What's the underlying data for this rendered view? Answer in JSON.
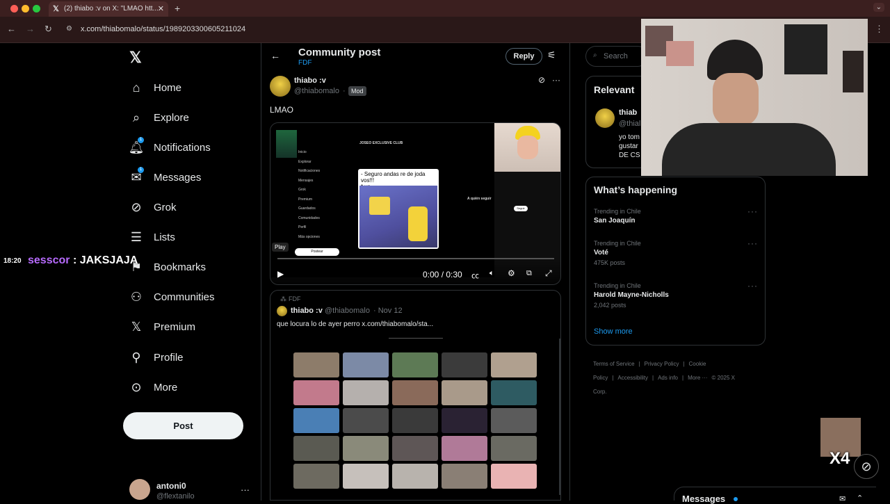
{
  "browser": {
    "tab_title": "(2) thiabo :v on X: \"LMAO htt...",
    "url": "x.com/thiabomalo/status/1989203300605211024"
  },
  "nav": {
    "items": [
      {
        "label": "Home",
        "icon": "home-icon"
      },
      {
        "label": "Explore",
        "icon": "search-icon"
      },
      {
        "label": "Notifications",
        "icon": "bell-icon",
        "badge": "1"
      },
      {
        "label": "Messages",
        "icon": "mail-icon",
        "badge": "1"
      },
      {
        "label": "Grok",
        "icon": "grok-icon"
      },
      {
        "label": "Lists",
        "icon": "list-icon"
      },
      {
        "label": "Bookmarks",
        "icon": "bookmark-icon"
      },
      {
        "label": "Communities",
        "icon": "people-icon"
      },
      {
        "label": "Premium",
        "icon": "x-icon"
      },
      {
        "label": "Profile",
        "icon": "person-icon"
      },
      {
        "label": "More",
        "icon": "more-circle-icon"
      }
    ],
    "post_label": "Post",
    "account": {
      "name": "antoni0",
      "handle": "@flextanilo"
    }
  },
  "chat_overlay": {
    "time": "18:20",
    "user": "sesscor",
    "sep": ":",
    "message": "JAKSJAJA"
  },
  "header": {
    "title": "Community post",
    "subtitle": "FDF",
    "reply_label": "Reply"
  },
  "post": {
    "author": "thiabo :v",
    "handle": "@thiabomalo",
    "dot": "·",
    "mod_badge": "Mod",
    "text": "LMAO",
    "video": {
      "play_label": "Play",
      "time": "0:00 / 0:30",
      "inner_header": "JOSEO EXCLUSIVE CLUB",
      "inner_bubble": "- Seguro andas re de joda vos!!!\n* yo ...",
      "inner_menu": [
        "Inicio",
        "Explorar",
        "Notificaciones",
        "Mensajes",
        "Grok",
        "Premium",
        "Guardados",
        "Comunidades",
        "Perfil",
        "Más opciones"
      ],
      "inner_post": "Postear",
      "inner_follow_title": "A quién seguir",
      "inner_follow": "Seguir"
    }
  },
  "quote": {
    "community": "FDF",
    "author": "thiabo :v",
    "handle": "@thiabomalo",
    "date": "· Nov 12",
    "text": "que locura lo de ayer perro  x.com/thiabomalo/sta..."
  },
  "right": {
    "search_placeholder": "Search",
    "relevant_title": "Relevant",
    "relevant_name": "thiab",
    "relevant_handle": "@thial",
    "relevant_text": [
      "yo tom",
      "gustar",
      "DE CS"
    ],
    "happening_title": "What’s happening",
    "trends": [
      {
        "meta": "Trending in Chile",
        "name": "San Joaquín",
        "posts": ""
      },
      {
        "meta": "Trending in Chile",
        "name": "Voté",
        "posts": "475K posts"
      },
      {
        "meta": "Trending in Chile",
        "name": "Harold Mayne-Nicholls",
        "posts": "2,042 posts"
      }
    ],
    "show_more": "Show more",
    "footer": [
      "Terms of Service",
      "|",
      "Privacy Policy",
      "|",
      "Cookie Policy",
      "|",
      "Accessibility",
      "|",
      "Ads info",
      "|",
      "More ···",
      "© 2025 X Corp."
    ]
  },
  "messages_drawer": {
    "label": "Messages"
  },
  "overlay_x4": "X4"
}
